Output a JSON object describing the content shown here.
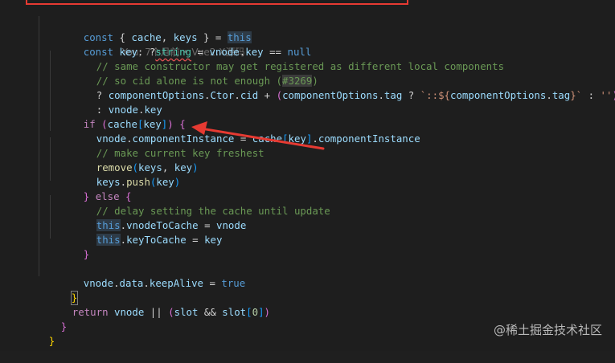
{
  "app": {
    "name": "Code editor",
    "language": "javascript",
    "theme_colors": {
      "background": "#1e1e1e",
      "keyword": "#569cd6",
      "control": "#c586c0",
      "variable": "#9cdcfe",
      "function": "#dcdcaa",
      "type": "#4ec9b0",
      "string": "#ce9178",
      "comment": "#6a9955",
      "number": "#b5cea8",
      "annotation_red": "#e63a32"
    }
  },
  "blame": {
    "text": "You, 7个月前 • Vue2.X源码"
  },
  "code_lines": [
    [
      {
        "t": "const ",
        "c": "kw"
      },
      {
        "t": "{ ",
        "c": "punc"
      },
      {
        "t": "cache",
        "c": "var"
      },
      {
        "t": ", ",
        "c": "punc"
      },
      {
        "t": "keys",
        "c": "var"
      },
      {
        "t": " } = ",
        "c": "punc"
      },
      {
        "t": "this",
        "c": "this-hl"
      }
    ],
    [
      {
        "t": "const ",
        "c": "kw"
      },
      {
        "t": "key",
        "c": "var"
      },
      {
        "t": ": ",
        "c": "punc"
      },
      {
        "t": "?",
        "c": "punc"
      },
      {
        "t": "string",
        "c": "type squiggle"
      },
      {
        "t": " = ",
        "c": "punc"
      },
      {
        "t": "vnode",
        "c": "var"
      },
      {
        "t": ".",
        "c": "punc"
      },
      {
        "t": "key",
        "c": "var"
      },
      {
        "t": " == ",
        "c": "punc"
      },
      {
        "t": "null",
        "c": "kw"
      }
    ],
    [
      {
        "t": "// same constructor may get registered as different local components",
        "c": "cmt"
      }
    ],
    [
      {
        "t": "// so cid alone is not enough (",
        "c": "cmt"
      },
      {
        "t": "#3269",
        "c": "cmt issue-hl"
      },
      {
        "t": ")",
        "c": "cmt"
      }
    ],
    [
      {
        "t": "? ",
        "c": "punc"
      },
      {
        "t": "componentOptions",
        "c": "var"
      },
      {
        "t": ".",
        "c": "punc"
      },
      {
        "t": "Ctor",
        "c": "var"
      },
      {
        "t": ".",
        "c": "punc"
      },
      {
        "t": "cid",
        "c": "var"
      },
      {
        "t": " + ",
        "c": "punc"
      },
      {
        "t": "(",
        "c": "paren"
      },
      {
        "t": "componentOptions",
        "c": "var"
      },
      {
        "t": ".",
        "c": "punc"
      },
      {
        "t": "tag",
        "c": "var"
      },
      {
        "t": " ? ",
        "c": "punc"
      },
      {
        "t": "`::${",
        "c": "str"
      },
      {
        "t": "componentOptions",
        "c": "var"
      },
      {
        "t": ".",
        "c": "punc"
      },
      {
        "t": "tag",
        "c": "var"
      },
      {
        "t": "}`",
        "c": "str"
      },
      {
        "t": " : ",
        "c": "punc"
      },
      {
        "t": "''",
        "c": "str"
      },
      {
        "t": ")",
        "c": "paren"
      }
    ],
    [
      {
        "t": ": ",
        "c": "punc"
      },
      {
        "t": "vnode",
        "c": "var"
      },
      {
        "t": ".",
        "c": "punc"
      },
      {
        "t": "key",
        "c": "var"
      }
    ],
    [
      {
        "t": "if ",
        "c": "ctl"
      },
      {
        "t": "(",
        "c": "paren"
      },
      {
        "t": "cache",
        "c": "var"
      },
      {
        "t": "[",
        "c": "bracket"
      },
      {
        "t": "key",
        "c": "var"
      },
      {
        "t": "]",
        "c": "bracket"
      },
      {
        "t": ") ",
        "c": "paren"
      },
      {
        "t": "{",
        "c": "paren"
      }
    ],
    [
      {
        "t": "vnode",
        "c": "var"
      },
      {
        "t": ".",
        "c": "punc"
      },
      {
        "t": "componentInstance",
        "c": "var"
      },
      {
        "t": " = ",
        "c": "punc"
      },
      {
        "t": "cache",
        "c": "var"
      },
      {
        "t": "[",
        "c": "bracket"
      },
      {
        "t": "key",
        "c": "var"
      },
      {
        "t": "]",
        "c": "bracket"
      },
      {
        "t": ".",
        "c": "punc"
      },
      {
        "t": "componentInstance",
        "c": "var"
      }
    ],
    [
      {
        "t": "// make current key freshest",
        "c": "cmt"
      }
    ],
    [
      {
        "t": "remove",
        "c": "fn"
      },
      {
        "t": "(",
        "c": "bracket"
      },
      {
        "t": "keys",
        "c": "var"
      },
      {
        "t": ", ",
        "c": "punc"
      },
      {
        "t": "key",
        "c": "var"
      },
      {
        "t": ")",
        "c": "bracket"
      }
    ],
    [
      {
        "t": "keys",
        "c": "var"
      },
      {
        "t": ".",
        "c": "punc"
      },
      {
        "t": "push",
        "c": "fn"
      },
      {
        "t": "(",
        "c": "bracket"
      },
      {
        "t": "key",
        "c": "var"
      },
      {
        "t": ")",
        "c": "bracket"
      }
    ],
    [
      {
        "t": "} ",
        "c": "paren"
      },
      {
        "t": "else ",
        "c": "ctl"
      },
      {
        "t": "{",
        "c": "paren"
      }
    ],
    [
      {
        "t": "// delay setting the cache until update",
        "c": "cmt"
      }
    ],
    [
      {
        "t": "this",
        "c": "this-hl"
      },
      {
        "t": ".",
        "c": "punc"
      },
      {
        "t": "vnodeToCache",
        "c": "var"
      },
      {
        "t": " = ",
        "c": "punc"
      },
      {
        "t": "vnode",
        "c": "var"
      }
    ],
    [
      {
        "t": "this",
        "c": "this-hl"
      },
      {
        "t": ".",
        "c": "punc"
      },
      {
        "t": "keyToCache",
        "c": "var"
      },
      {
        "t": " = ",
        "c": "punc"
      },
      {
        "t": "key",
        "c": "var"
      }
    ],
    [
      {
        "t": "}",
        "c": "paren"
      }
    ],
    [],
    [
      {
        "t": "vnode",
        "c": "var"
      },
      {
        "t": ".",
        "c": "punc"
      },
      {
        "t": "data",
        "c": "var"
      },
      {
        "t": ".",
        "c": "punc"
      },
      {
        "t": "keepAlive",
        "c": "var"
      },
      {
        "t": " = ",
        "c": "punc"
      },
      {
        "t": "true",
        "c": "kw"
      }
    ],
    [
      {
        "t": "}",
        "c": "brace"
      }
    ],
    [
      {
        "t": "return ",
        "c": "ctl"
      },
      {
        "t": "vnode",
        "c": "var"
      },
      {
        "t": " || ",
        "c": "punc"
      },
      {
        "t": "(",
        "c": "paren"
      },
      {
        "t": "slot",
        "c": "var"
      },
      {
        "t": " && ",
        "c": "punc"
      },
      {
        "t": "slot",
        "c": "var"
      },
      {
        "t": "[",
        "c": "bracket"
      },
      {
        "t": "0",
        "c": "num"
      },
      {
        "t": "]",
        "c": "bracket"
      },
      {
        "t": ")",
        "c": "paren"
      }
    ],
    [
      {
        "t": "}",
        "c": "paren"
      }
    ],
    [
      {
        "t": "}",
        "c": "brace"
      }
    ]
  ],
  "watermark": {
    "text": "@稀土掘金技术社区"
  }
}
